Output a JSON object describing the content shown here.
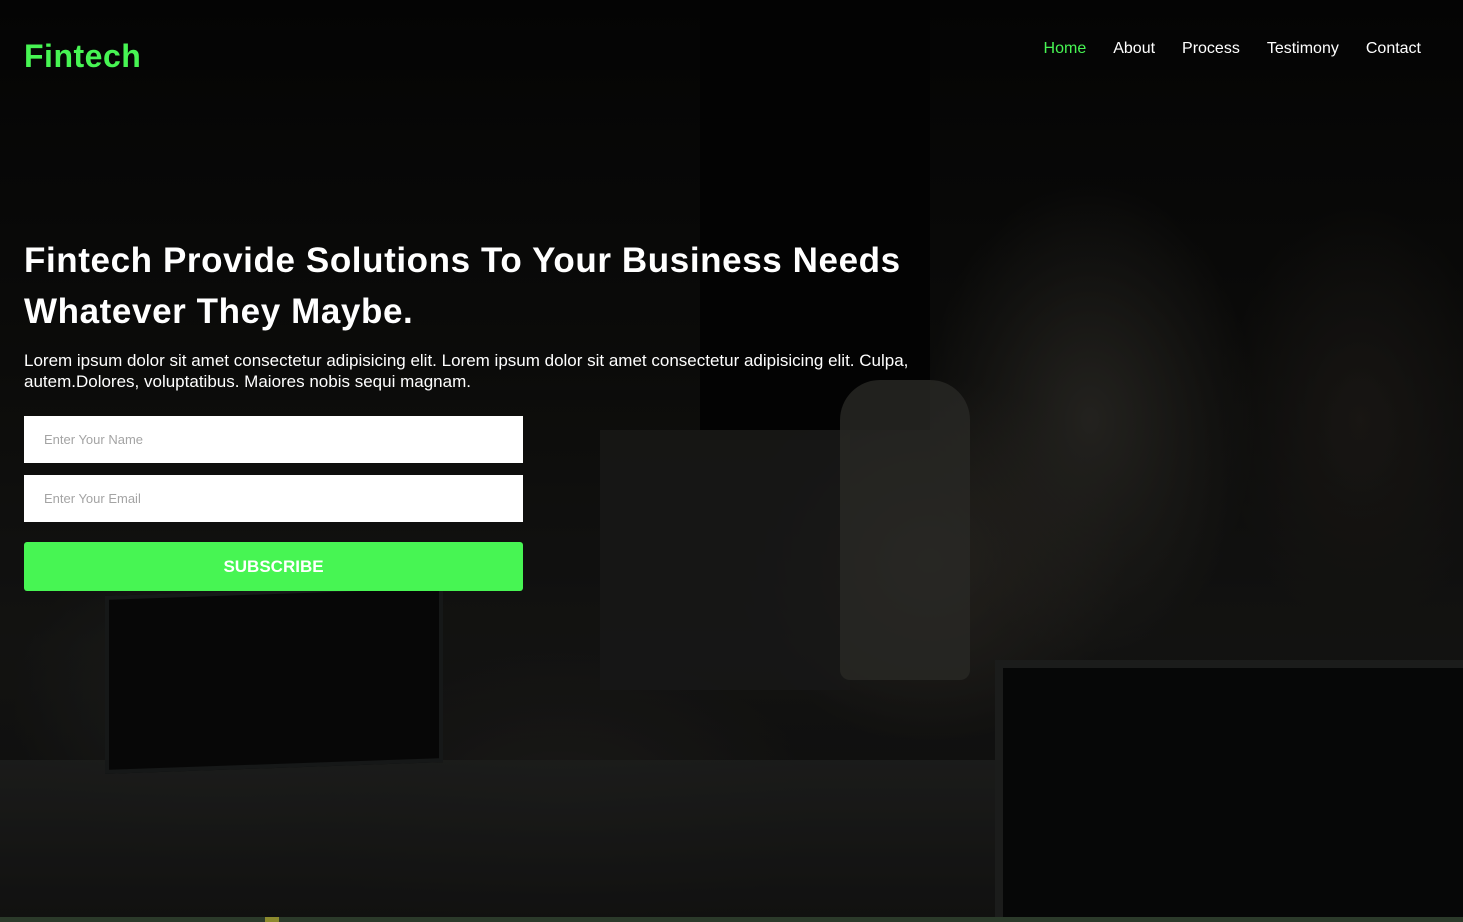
{
  "brand": {
    "logo": "Fintech",
    "accent_color": "#47f553"
  },
  "nav": {
    "items": [
      "Home",
      "About",
      "Process",
      "Testimony",
      "Contact"
    ],
    "active": "Home"
  },
  "hero": {
    "title": "Fintech Provide Solutions To Your Business Needs Whatever They Maybe.",
    "subtitle": "Lorem ipsum dolor sit amet consectetur adipisicing elit. Lorem ipsum dolor sit amet consectetur adipisicing elit. Culpa, autem.Dolores, voluptatibus. Maiores nobis sequi magnam.",
    "background": "dark office photo with people at computers"
  },
  "form": {
    "name_placeholder": "Enter Your Name",
    "email_placeholder": "Enter Your Email",
    "subscribe_label": "SUBSCRIBE"
  }
}
